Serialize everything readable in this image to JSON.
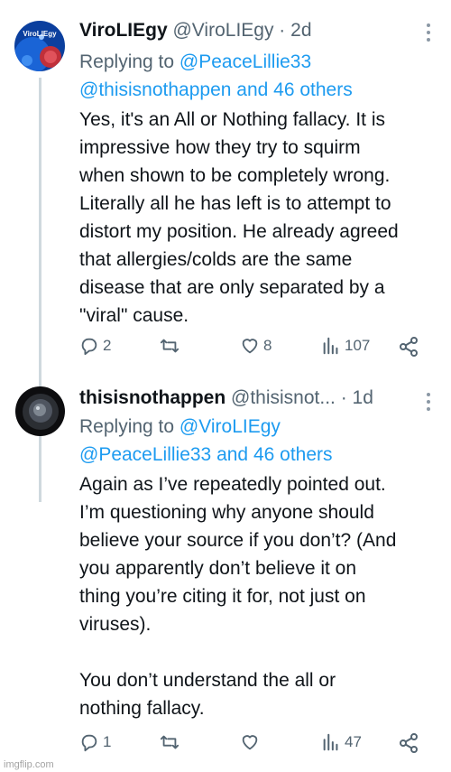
{
  "tweets": [
    {
      "display_name": "ViroLIEgy",
      "handle": "@ViroLIEgy",
      "time": "2d",
      "avatar_text": "ViroLIEgy",
      "replying_prefix": "Replying to ",
      "replying_first": "@PeaceLillie33",
      "replying_second": "@thisisnothappen and 46 others",
      "text": "Yes, it's an All or Nothing fallacy. It is\nimpressive how they try to squirm\nwhen shown to be completely wrong.\nLiterally all he has left is to attempt to\ndistort my position. He already agreed\nthat allergies/colds are the same\ndisease that are only separated by a\n\"viral\" cause.",
      "replies": "2",
      "retweets": "",
      "likes": "8",
      "views": "107"
    },
    {
      "display_name": "thisisnothappen",
      "handle": "@thisisnot...",
      "time": "1d",
      "replying_prefix": "Replying to ",
      "replying_first": "@ViroLIEgy",
      "replying_second": "@PeaceLillie33 and 46 others",
      "text": "Again as I’ve repeatedly pointed out.\nI’m questioning why anyone should\nbelieve your source if you don’t? (And\nyou apparently don’t believe it on\nthing you’re citing it for, not just on\nviruses).\n\nYou don’t understand the all or\nnothing fallacy.",
      "replies": "1",
      "retweets": "",
      "likes": "",
      "views": "47"
    }
  ],
  "separator": " · ",
  "watermark": "imgflip.com",
  "colors": {
    "link": "#1d9bf0",
    "muted": "#536471",
    "text": "#0f1419",
    "thread_line": "#cfd9de"
  },
  "icons": [
    "reply-icon",
    "retweet-icon",
    "like-icon",
    "views-icon",
    "share-icon",
    "more-options-icon"
  ]
}
